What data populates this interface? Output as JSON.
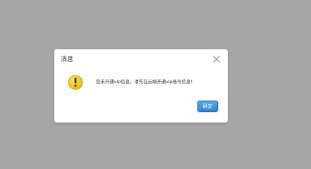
{
  "dialog": {
    "title": "消息",
    "message": "您未开通vip信息，请先在云端开通vip账号信息！",
    "ok_label": "确定"
  },
  "icons": {
    "close": "close-icon",
    "warning": "warning-icon"
  },
  "colors": {
    "backdrop": "#a5a6a5",
    "dialog_bg": "#ffffff",
    "warning_fill": "#f3c500",
    "button_bg": "#3a8fd6"
  }
}
